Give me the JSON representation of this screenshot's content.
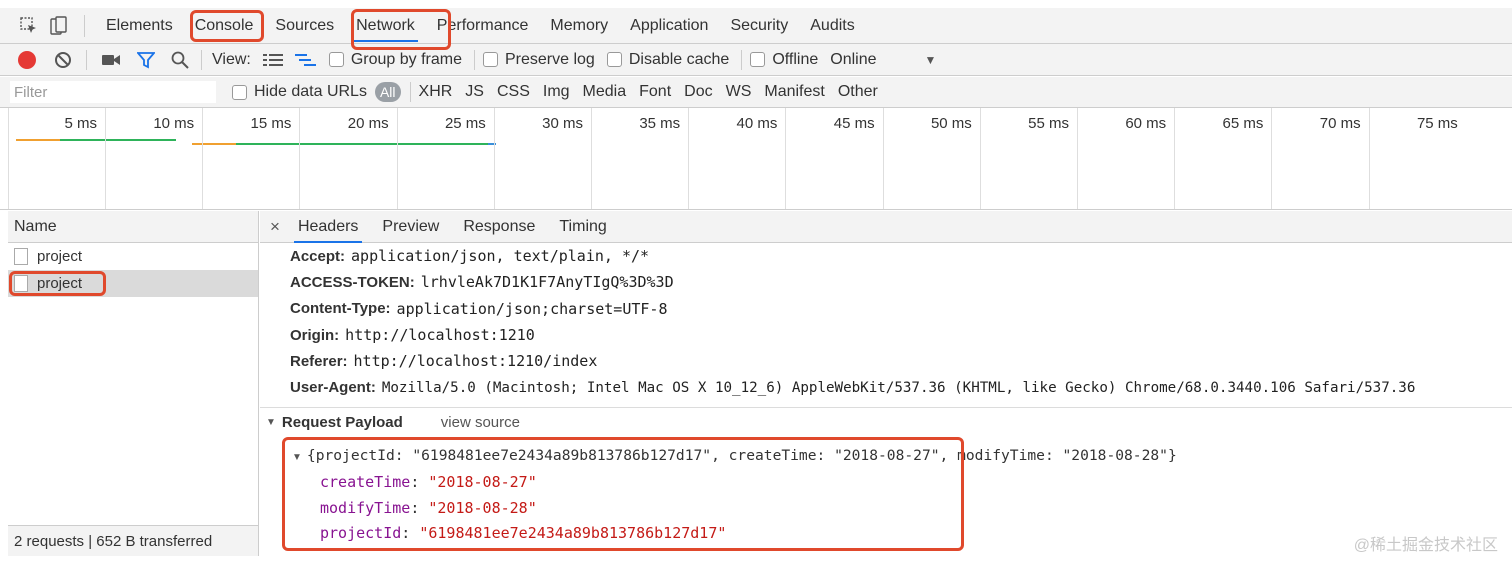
{
  "tabs": [
    "Elements",
    "Console",
    "Sources",
    "Network",
    "Performance",
    "Memory",
    "Application",
    "Security",
    "Audits"
  ],
  "toolbar": {
    "view_label": "View:",
    "group_by_frame": "Group by frame",
    "preserve_log": "Preserve log",
    "disable_cache": "Disable cache",
    "offline": "Offline",
    "throttle": "Online"
  },
  "filter": {
    "placeholder": "Filter",
    "hide_data_urls": "Hide data URLs",
    "types": [
      "All",
      "XHR",
      "JS",
      "CSS",
      "Img",
      "Media",
      "Font",
      "Doc",
      "WS",
      "Manifest",
      "Other"
    ]
  },
  "timeline": {
    "ticks": [
      "5 ms",
      "10 ms",
      "15 ms",
      "20 ms",
      "25 ms",
      "30 ms",
      "35 ms",
      "40 ms",
      "45 ms",
      "50 ms",
      "55 ms",
      "60 ms",
      "65 ms",
      "70 ms",
      "75 ms"
    ]
  },
  "requests": {
    "column": "Name",
    "items": [
      "project",
      "project"
    ],
    "summary": "2 requests | 652 B transferred"
  },
  "detail": {
    "close": "×",
    "tabs": [
      "Headers",
      "Preview",
      "Response",
      "Timing"
    ],
    "headers": [
      {
        "k": "Accept:",
        "v": "application/json, text/plain, */*"
      },
      {
        "k": "ACCESS-TOKEN:",
        "v": "lrhvleAk7D1K1F7AnyTIgQ%3D%3D"
      },
      {
        "k": "Content-Type:",
        "v": "application/json;charset=UTF-8"
      },
      {
        "k": "Origin:",
        "v": "http://localhost:1210"
      },
      {
        "k": "Referer:",
        "v": "http://localhost:1210/index"
      },
      {
        "k": "User-Agent:",
        "v": "Mozilla/5.0 (Macintosh; Intel Mac OS X 10_12_6) AppleWebKit/537.36 (KHTML, like Gecko) Chrome/68.0.3440.106 Safari/537.36"
      }
    ],
    "payload_title": "Request Payload",
    "view_source": "view source",
    "payload_summary": "{projectId: \"6198481ee7e2434a89b813786b127d17\", createTime: \"2018-08-27\", modifyTime: \"2018-08-28\"}",
    "payload": [
      {
        "k": "createTime",
        "v": "\"2018-08-27\""
      },
      {
        "k": "modifyTime",
        "v": "\"2018-08-28\""
      },
      {
        "k": "projectId",
        "v": "\"6198481ee7e2434a89b813786b127d17\""
      }
    ]
  },
  "watermark": "@稀土掘金技术社区",
  "colors": {
    "highlight": "#e0492c",
    "accent": "#1a73e8",
    "record": "#e53935"
  }
}
